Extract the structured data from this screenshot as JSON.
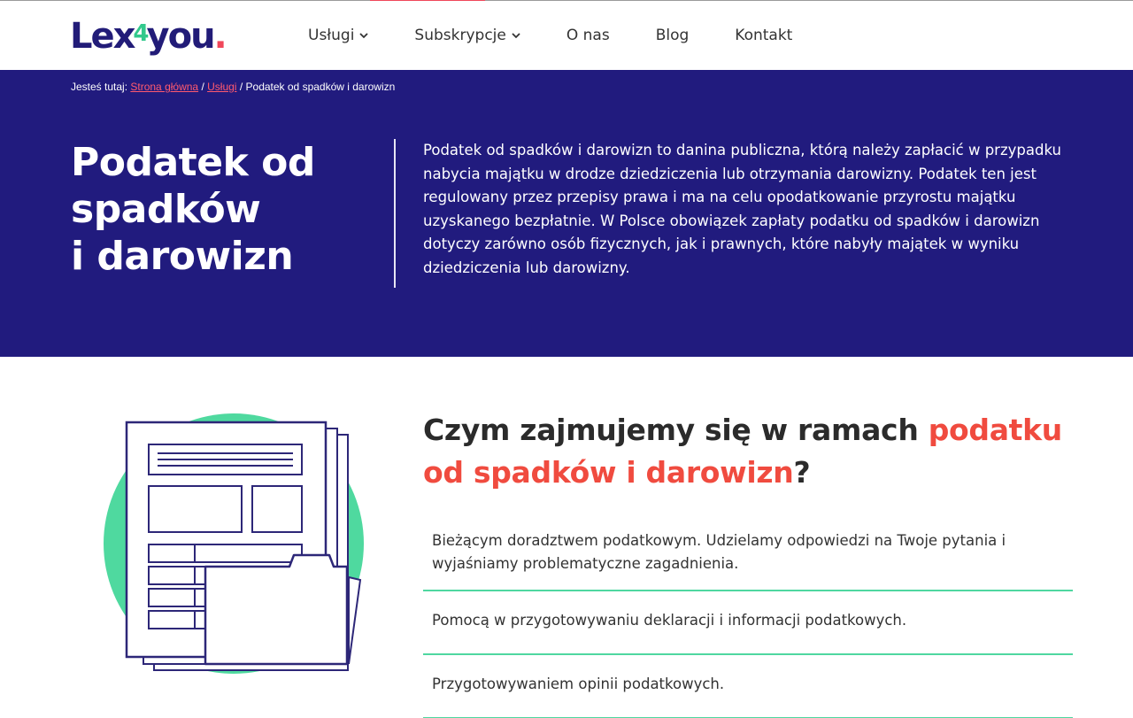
{
  "header": {
    "logo": {
      "part1": "Lex",
      "part2": "4",
      "part3": "you",
      "dot": "."
    },
    "nav": [
      {
        "label": "Usługi",
        "has_dropdown": true
      },
      {
        "label": "Subskrypcje",
        "has_dropdown": true
      },
      {
        "label": "O nas",
        "has_dropdown": false
      },
      {
        "label": "Blog",
        "has_dropdown": false
      },
      {
        "label": "Kontakt",
        "has_dropdown": false
      }
    ]
  },
  "breadcrumb": {
    "prefix": "Jesteś tutaj:",
    "home": "Strona główna",
    "sep1": "/",
    "services": "Usługi",
    "sep2": "/",
    "current": "Podatek od spadków i darowizn"
  },
  "hero": {
    "title_line1": "Podatek od",
    "title_line2": "spadków",
    "title_line3": "i darowizn",
    "description": "Podatek od spadków i darowizn to danina publiczna, którą należy zapłacić w przypadku nabycia majątku w drodze dziedziczenia lub otrzymania darowizny. Podatek ten jest regulowany przez przepisy prawa i ma na celu opodatkowanie przyrostu majątku uzyskanego bezpłatnie. W Polsce obowiązek zapłaty podatku od spadków i darowizn dotyczy zarówno osób fizycznych, jak i prawnych, które nabyły majątek w wyniku dziedziczenia lub darowizny."
  },
  "section": {
    "title_plain": "Czym zajmujemy się w ramach ",
    "title_accent": "podatku od spadków i darowizn",
    "title_end": "?",
    "items": [
      "Bieżącym doradztwem podatkowym. Udzielamy odpowiedzi na Twoje pytania i wyjaśniamy problematyczne zagadnienia.",
      "Pomocą w przygotowywaniu deklaracji i informacji podatkowych.",
      "Przygotowywaniem opinii podatkowych."
    ]
  },
  "colors": {
    "brand_navy": "#211b7e",
    "accent_red": "#f04b3f",
    "accent_green": "#4fd7a0"
  }
}
